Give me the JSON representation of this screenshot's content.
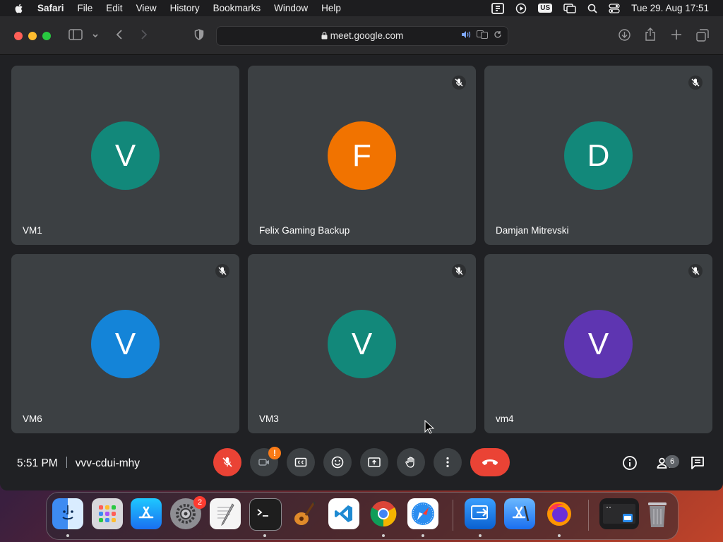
{
  "menubar": {
    "app_name": "Safari",
    "items": [
      "File",
      "Edit",
      "View",
      "History",
      "Bookmarks",
      "Window",
      "Help"
    ],
    "input_source": "US",
    "clock": "Tue 29. Aug  17:51"
  },
  "browser": {
    "url": "meet.google.com"
  },
  "meet": {
    "time": "5:51 PM",
    "meeting_code": "vvv-cdui-mhy",
    "participant_count": "6",
    "camera_warning": "!",
    "tiles": [
      {
        "initial": "V",
        "name": "VM1",
        "avatar_color": "#12887a",
        "muted": false
      },
      {
        "initial": "F",
        "name": "Felix Gaming Backup",
        "avatar_color": "#f17300",
        "muted": true
      },
      {
        "initial": "D",
        "name": "Damjan Mitrevski",
        "avatar_color": "#12887a",
        "muted": true
      },
      {
        "initial": "V",
        "name": "VM6",
        "avatar_color": "#1484d8",
        "muted": true
      },
      {
        "initial": "V",
        "name": "VM3",
        "avatar_color": "#12887a",
        "muted": true
      },
      {
        "initial": "V",
        "name": "vm4",
        "avatar_color": "#5e35b1",
        "muted": true
      }
    ]
  },
  "dock": {
    "settings_badge": "2",
    "apps": [
      "finder-icon",
      "launchpad-icon",
      "app-store-icon",
      "system-settings-icon",
      "textedit-icon",
      "terminal-icon",
      "garageband-icon",
      "vscode-icon",
      "chrome-icon",
      "safari-icon",
      "remote-desktop-icon",
      "xcode-icon",
      "firefox-icon",
      "screenshot-preview-icon",
      "trash-icon"
    ]
  },
  "colors": {
    "tile_bg": "#3c4043",
    "meet_bg": "#202124",
    "end_call": "#ea4335"
  }
}
